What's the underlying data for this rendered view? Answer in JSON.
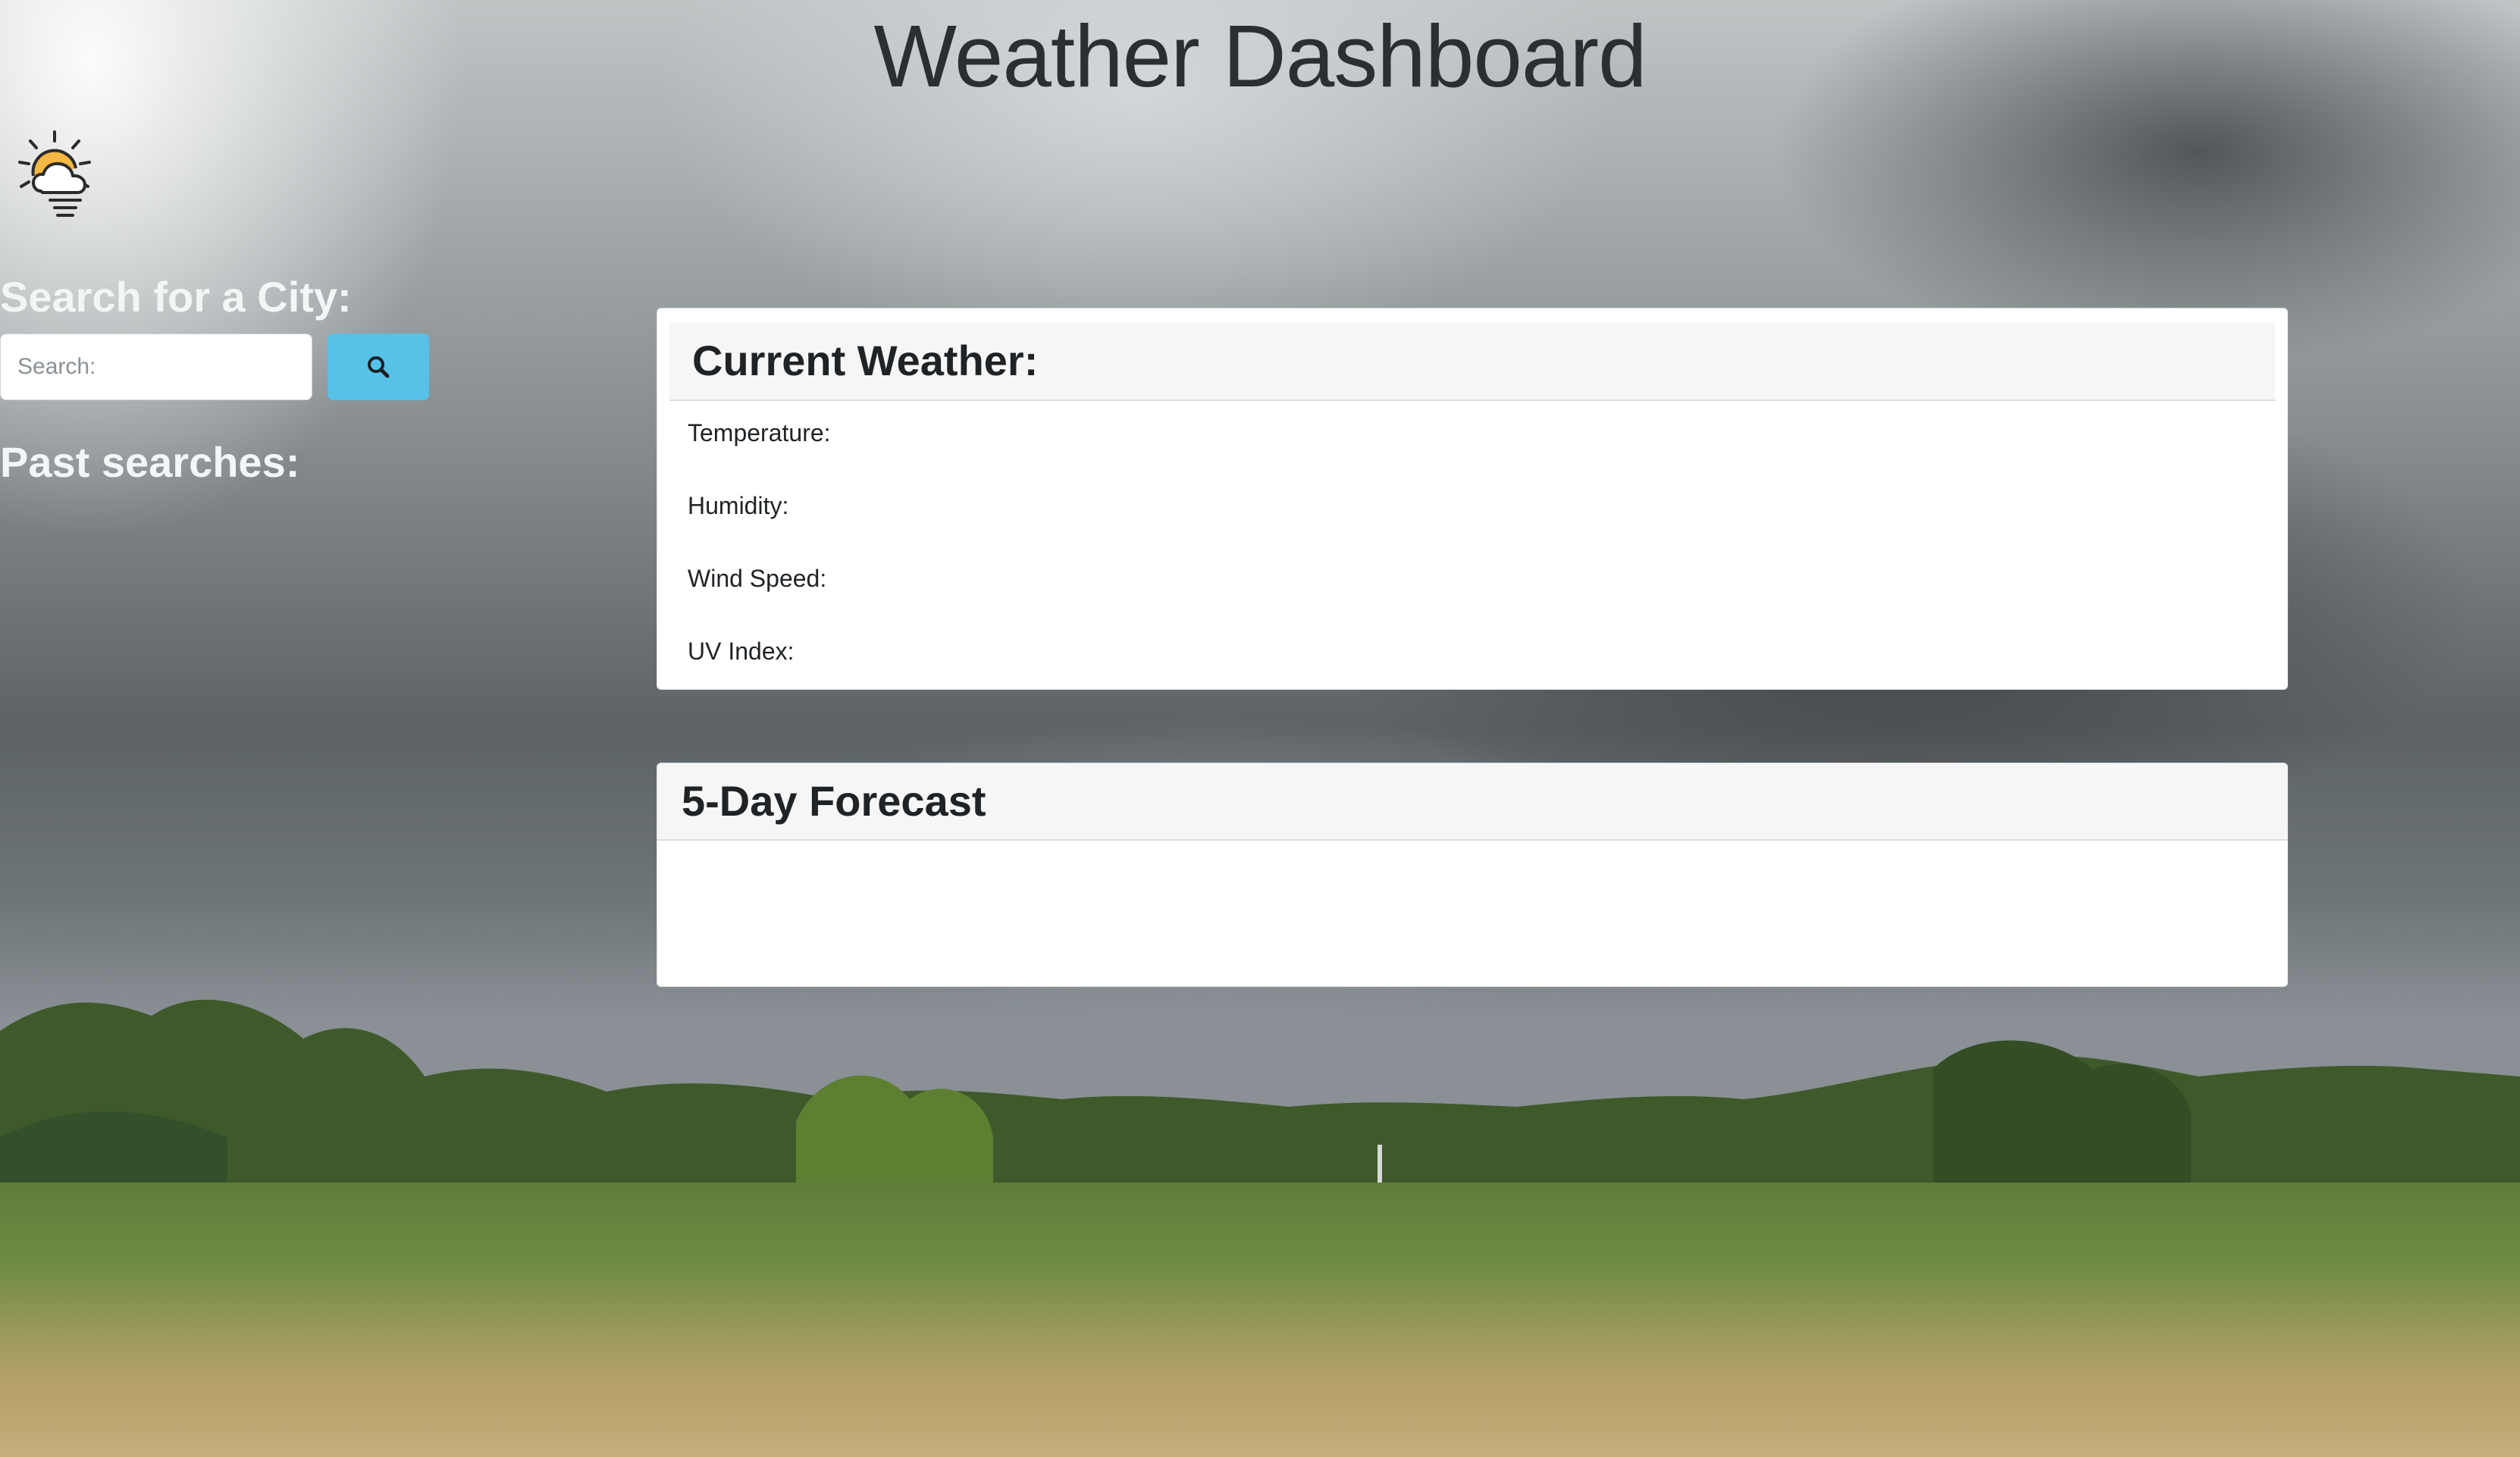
{
  "page": {
    "title": "Weather Dashboard"
  },
  "logo": {
    "icon": "sun-behind-cloud-icon",
    "sun_color": "#f5b843",
    "stroke_color": "#2b2b2b"
  },
  "sidebar": {
    "search_heading": "Search for a City:",
    "search_placeholder": "Search:",
    "search_value": "",
    "search_button_icon": "search-icon",
    "search_button_color": "#57c1e7",
    "past_searches_heading": "Past searches:",
    "past_searches": []
  },
  "current_weather": {
    "title": "Current Weather:",
    "metrics": [
      {
        "label": "Temperature:"
      },
      {
        "label": "Humidity:"
      },
      {
        "label": "Wind Speed:"
      },
      {
        "label": "UV Index:"
      }
    ]
  },
  "forecast": {
    "title": "5-Day Forecast",
    "days": []
  }
}
